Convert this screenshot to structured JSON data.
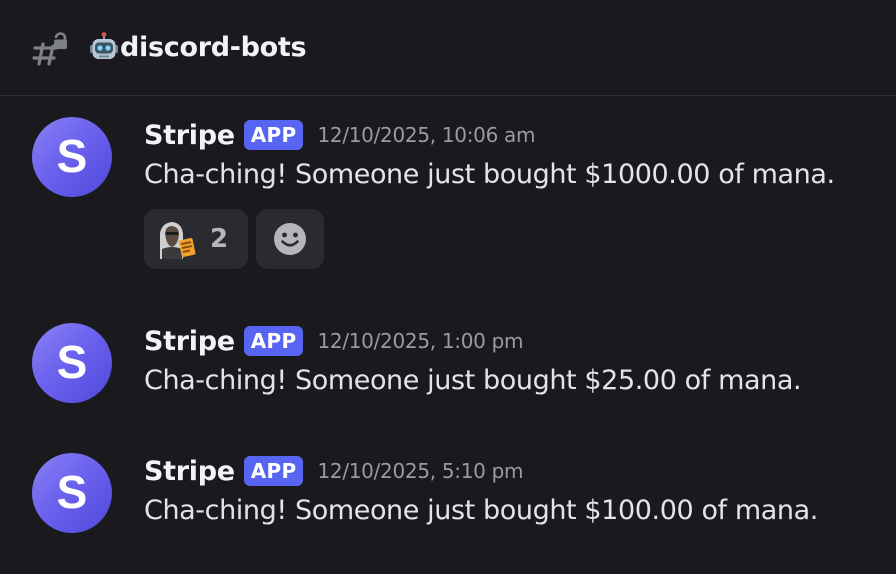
{
  "channel": {
    "name": "discord-bots",
    "emoji": "robot-icon"
  },
  "colors": {
    "background": "#1a1a1e",
    "app_badge": "#5865f2",
    "avatar_gradient_start": "#8a82f4",
    "avatar_gradient_end": "#4f48d9",
    "reaction_bg": "#2a2b30"
  },
  "messages": [
    {
      "author": "Stripe",
      "badge": "APP",
      "avatar_letter": "S",
      "timestamp": "12/10/2025, 10:06 am",
      "text": "Cha-ching! Someone just bought $1000.00 of mana.",
      "reactions": [
        {
          "icon": "custom-emoji-icon",
          "count": "2"
        },
        {
          "icon": "add-reaction-icon"
        }
      ]
    },
    {
      "author": "Stripe",
      "badge": "APP",
      "avatar_letter": "S",
      "timestamp": "12/10/2025, 1:00 pm",
      "text": "Cha-ching! Someone just bought $25.00 of mana."
    },
    {
      "author": "Stripe",
      "badge": "APP",
      "avatar_letter": "S",
      "timestamp": "12/10/2025, 5:10 pm",
      "text": "Cha-ching! Someone just bought $100.00 of mana."
    }
  ]
}
